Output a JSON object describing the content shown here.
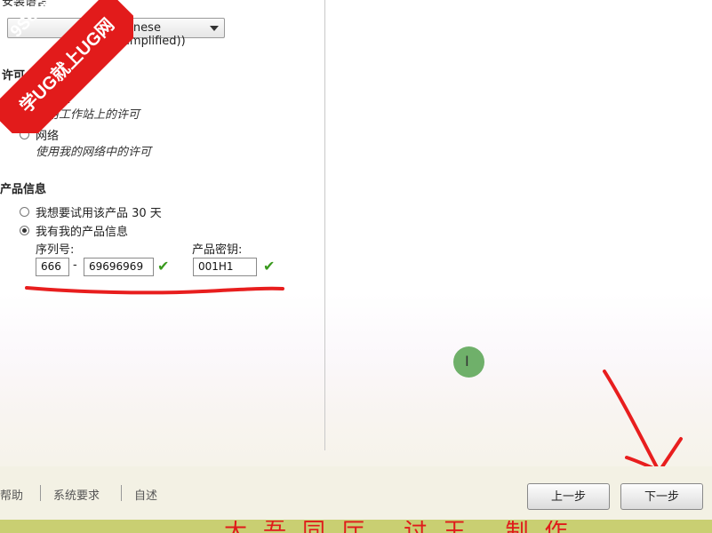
{
  "language": {
    "label": "安装语言",
    "selected": "Chinese (Simplified))"
  },
  "license_type": {
    "title": "许可",
    "options": [
      {
        "label": "单机版",
        "desc": "使用工作站上的许可",
        "selected": false
      },
      {
        "label": "网络",
        "desc": "使用我的网络中的许可",
        "selected": false
      }
    ]
  },
  "product_info": {
    "title": "产品信息",
    "trial_label": "我想要试用该产品 30 天",
    "have_info_label": "我有我的产品信息",
    "serial_label": "序列号:",
    "serial_prefix": "666",
    "serial_dash": "-",
    "serial_number": "69696969",
    "key_label": "产品密钥:",
    "key_value": "001H1"
  },
  "footer": {
    "links": [
      "帮助",
      "系统要求",
      "自述"
    ],
    "back_label": "上一步",
    "next_label": "下一步"
  },
  "overlay": {
    "watermark_line1": "9SUG",
    "watermark_line2": "学UG就上UG网",
    "bottom_text": "大吾同厅 讨王 制作",
    "cursor_glyph": "I"
  },
  "colors": {
    "accent_red": "#e01a1a",
    "check_green": "#3a9a1e",
    "footer_bg": "#f3f1e4"
  }
}
